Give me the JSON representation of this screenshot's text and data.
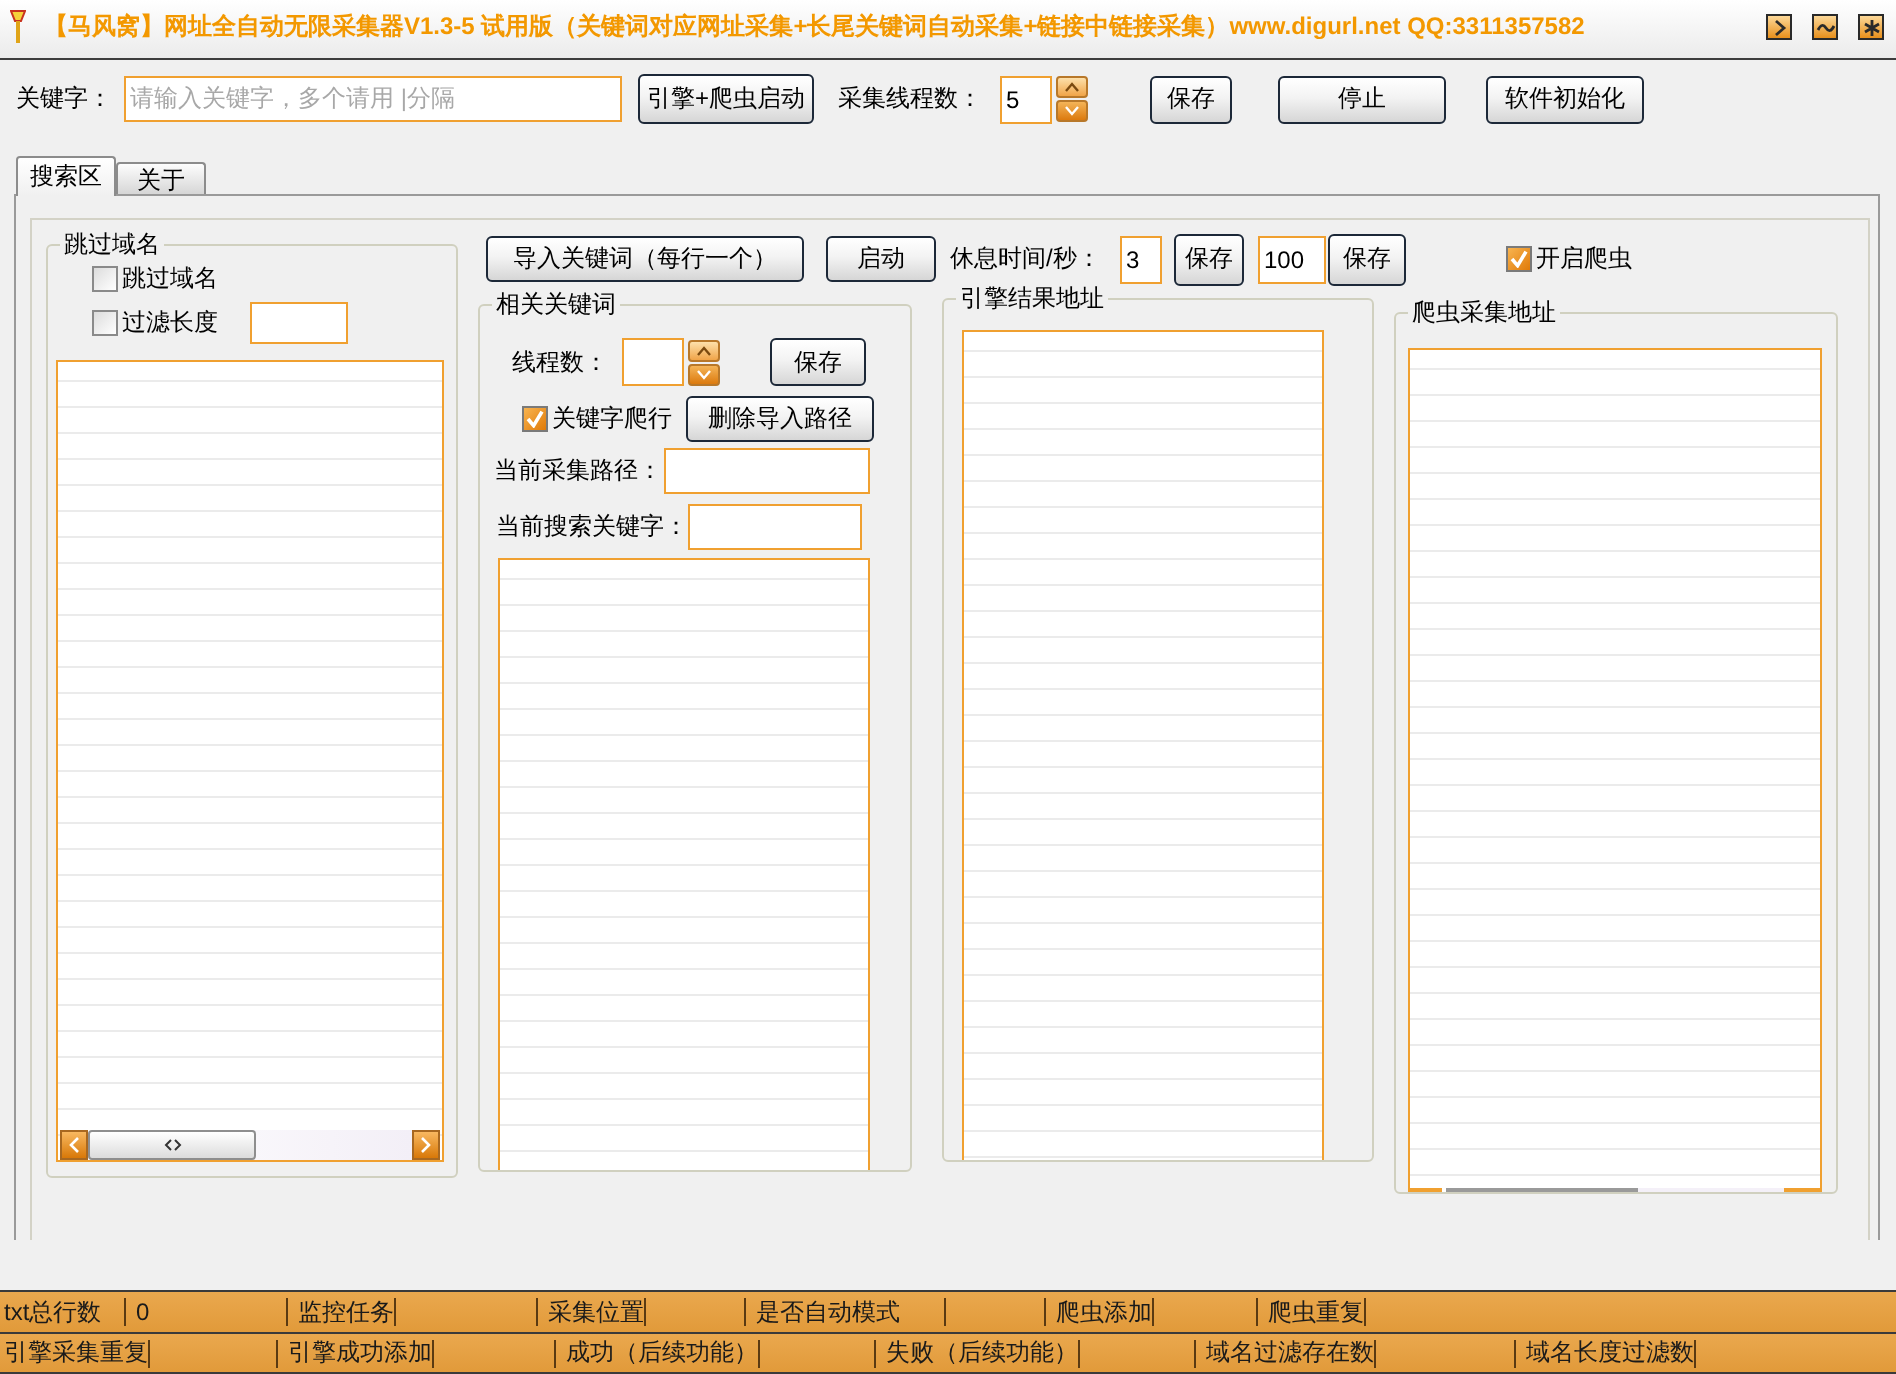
{
  "window": {
    "title": "【马风窝】网址全自动无限采集器V1.3-5 试用版（关键词对应网址采集+长尾关键词自动采集+链接中链接采集）www.digurl.net QQ:3311357582"
  },
  "toolbar": {
    "keyword_label": "关键字：",
    "keyword_field": {
      "placeholder": "请输入关键字，多个请用 |分隔"
    },
    "start_button": "引擎+爬虫启动",
    "thread_label": "采集线程数：",
    "thread_field": {
      "value": "5"
    },
    "buttons": [
      "保存",
      "停止",
      "软件初始化"
    ]
  },
  "tabs": [
    {
      "label": "搜索区",
      "selected": true
    },
    {
      "label": "关于",
      "selected": false
    }
  ],
  "skip_domain_group": {
    "title": "跳过域名",
    "options": [
      {
        "kind": "check",
        "label": "跳过域名",
        "checked": false
      },
      {
        "kind": "check_with_field",
        "label": "过滤长度",
        "checked": false
      }
    ]
  },
  "search_controls": {
    "import_button": "导入关键词（每行一个）",
    "start_button": "启动",
    "rest_label": "休息时间/秒：",
    "rest_field": {
      "value": "3"
    },
    "rest_save_button": "保存",
    "limit_field": {
      "value": "100"
    },
    "limit_save_button": "保存",
    "crawler_option": {
      "label": "开启爬虫",
      "checked": true
    }
  },
  "related_keywords_group": {
    "title": "相关关键词",
    "thread_label": "线程数：",
    "save_button": "保存",
    "crawl_option": {
      "label": "关键字爬行",
      "checked": true
    },
    "delete_button": "删除导入路径",
    "path_label": "当前采集路径：",
    "keyword_label": "当前搜索关键字："
  },
  "engine_results_group": {
    "title": "引擎结果地址"
  },
  "crawler_urls_group": {
    "title": "爬虫采集地址"
  },
  "status_rows": [
    [
      "txt总行数",
      "0",
      "监控任务",
      "采集位置",
      "是否自动模式",
      "爬虫添加",
      "爬虫重复"
    ],
    [
      "引擎采集重复",
      "引擎成功添加",
      "成功（后续功能）",
      "失败（后续功能）",
      "域名过滤存在数",
      "域名长度过滤数"
    ]
  ]
}
